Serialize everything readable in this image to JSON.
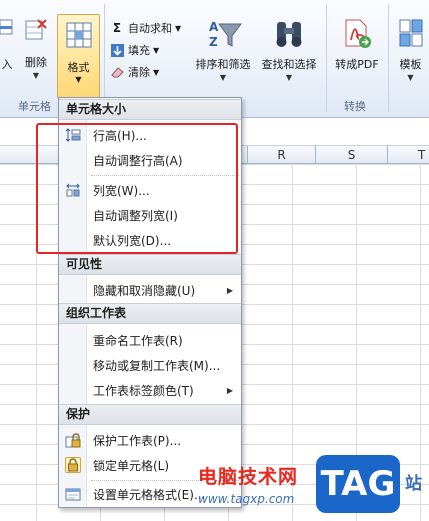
{
  "ribbon": {
    "delete_label": "删除",
    "format_label": "格式",
    "cells_group_label": "单元格",
    "autosum_label": "自动求和",
    "fill_label": "填充",
    "clear_label": "清除",
    "sort_filter_label": "排序和筛选",
    "find_select_label": "查找和选择",
    "to_pdf_label": "转成PDF",
    "convert_group_label": "转换",
    "template_label": "模板"
  },
  "columns": [
    "R",
    "S",
    "T"
  ],
  "menu": {
    "cell_size_header": "单元格大小",
    "row_height": "行高(H)...",
    "autofit_row": "自动调整行高(A)",
    "col_width": "列宽(W)...",
    "autofit_col": "自动调整列宽(I)",
    "default_width": "默认列宽(D)...",
    "visibility_header": "可见性",
    "hide_unhide": "隐藏和取消隐藏(U)",
    "organize_header": "组织工作表",
    "rename_sheet": "重命名工作表(R)",
    "move_copy_sheet": "移动或复制工作表(M)...",
    "tab_color": "工作表标签颜色(T)",
    "protect_header": "保护",
    "protect_sheet": "保护工作表(P)...",
    "lock_cell": "锁定单元格(L)",
    "format_cells": "设置单元格格式(E)..."
  },
  "watermark": {
    "site_name": "电脑技术网",
    "url": "www.tagxp.com",
    "tag": "TAG",
    "zhan": "站"
  },
  "colors": {
    "highlight": "#e0262a",
    "watermark_red": "#e8271e",
    "watermark_blue": "#1b66c9"
  }
}
